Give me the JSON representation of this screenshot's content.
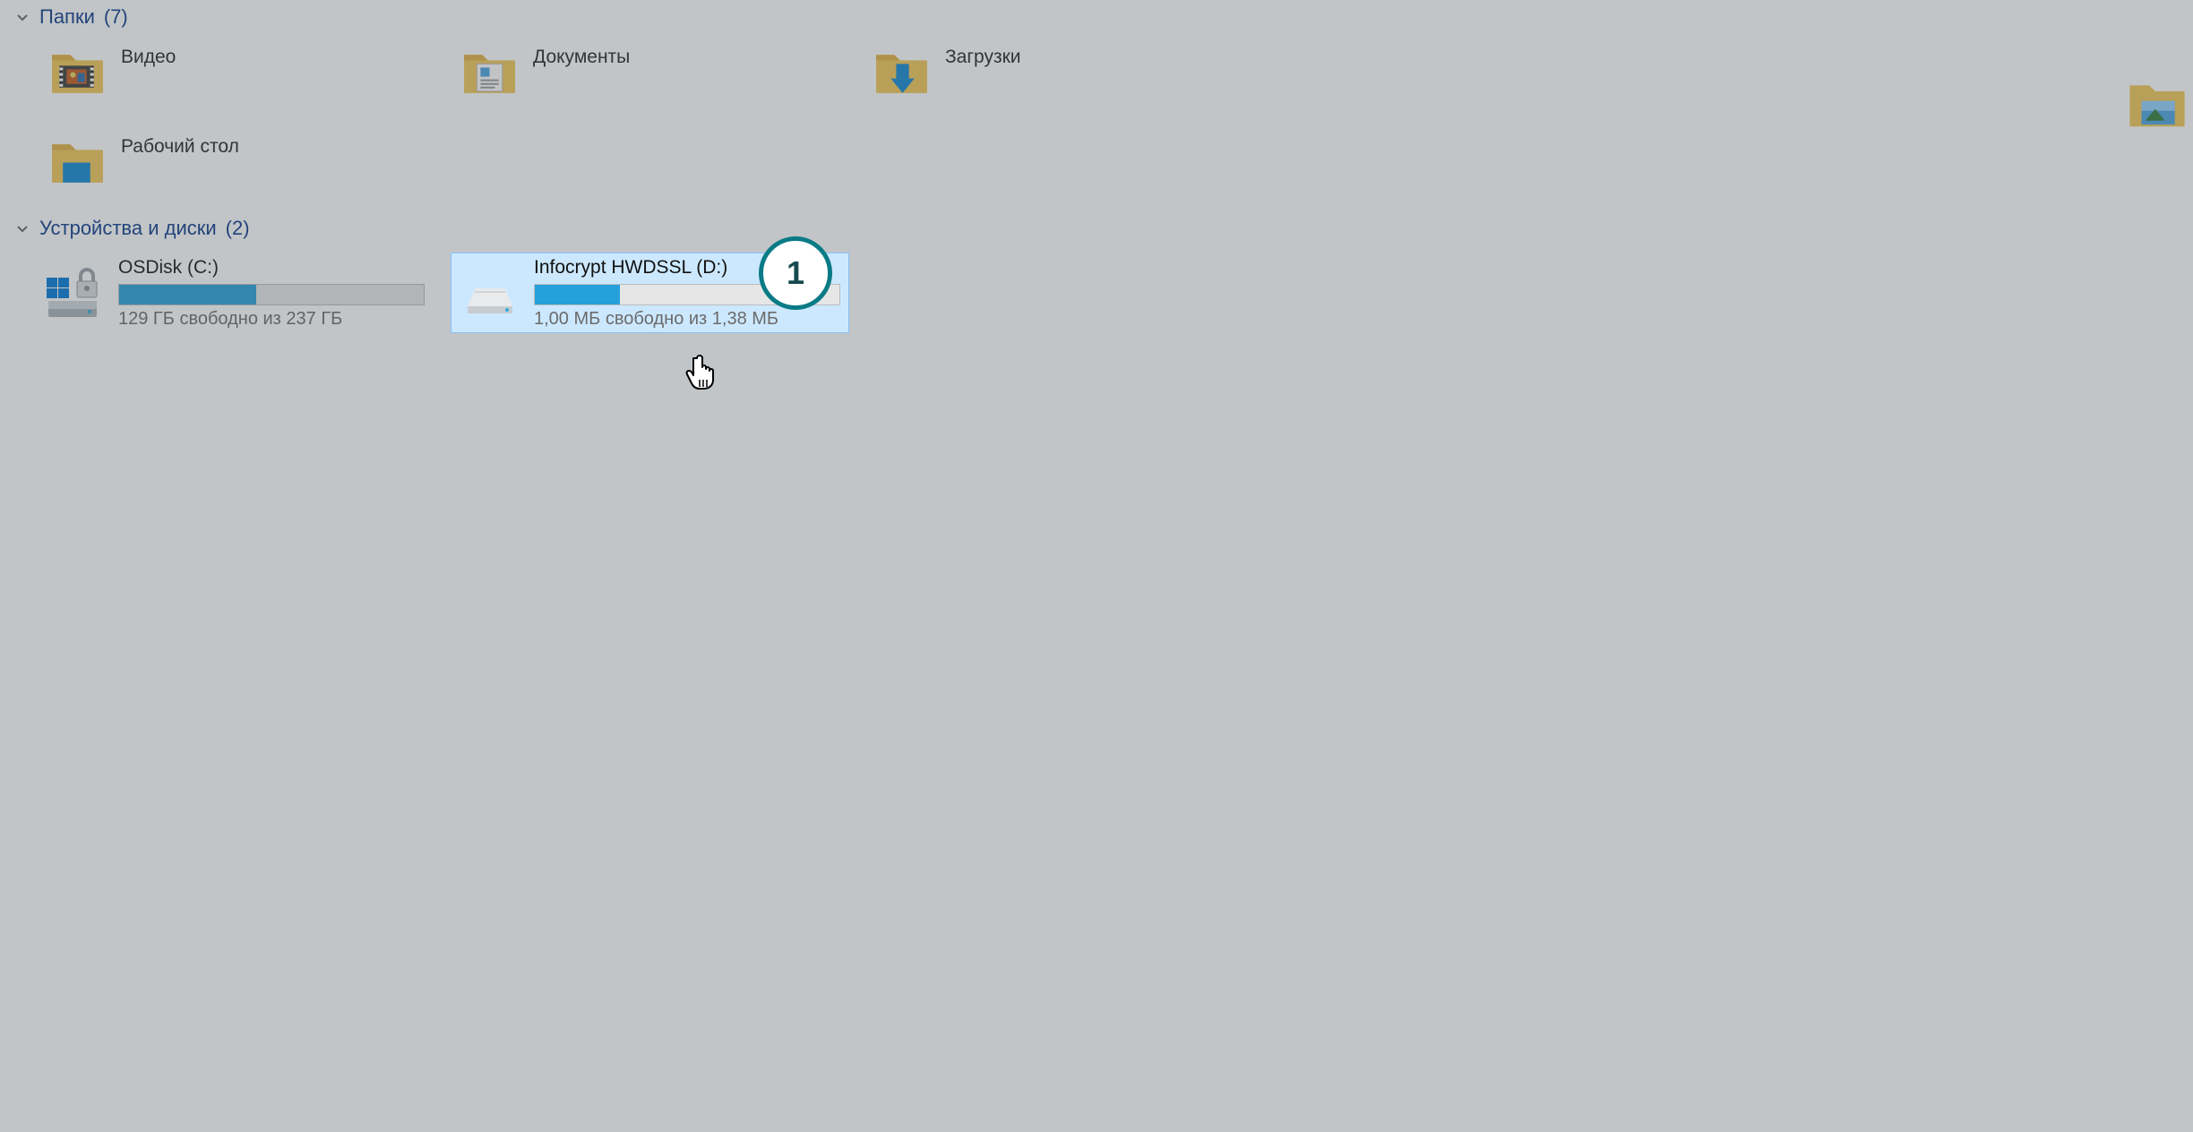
{
  "sections": {
    "folders": {
      "title": "Папки",
      "count_display": "(7)",
      "items": [
        {
          "label": "Видео"
        },
        {
          "label": "Документы"
        },
        {
          "label": "Загрузки"
        },
        {
          "label": "Рабочий стол"
        }
      ]
    },
    "drives": {
      "title": "Устройства и диски",
      "count_display": "(2)",
      "items": [
        {
          "name": "OSDisk (C:)",
          "free_text": "129 ГБ свободно из 237 ГБ",
          "used_percent": 45
        },
        {
          "name": "Infocrypt HWDSSL (D:)",
          "free_text": "1,00 МБ свободно из 1,38 МБ",
          "used_percent": 28,
          "selected": true
        }
      ]
    }
  },
  "callout": {
    "number": "1"
  },
  "colors": {
    "section_title": "#0a3a8a",
    "progress_fill": "#26a0da",
    "selection_bg": "#cce8ff",
    "selection_border": "#84c1ff",
    "callout_ring": "#0a7b86"
  }
}
